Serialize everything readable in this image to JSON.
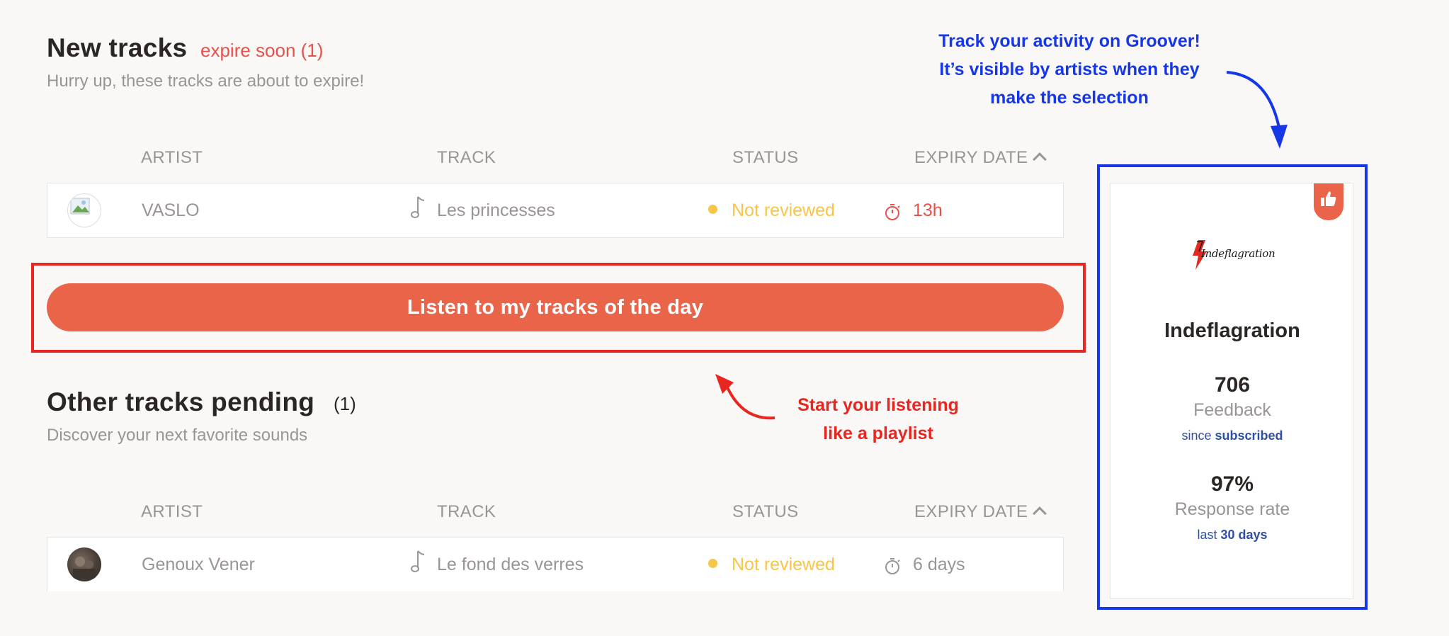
{
  "new_tracks": {
    "title": "New tracks",
    "expire_note": "expire soon (1)",
    "subtitle": "Hurry up, these tracks are about to expire!",
    "columns": [
      "ARTIST",
      "TRACK",
      "STATUS",
      "EXPIRY DATE"
    ],
    "rows": [
      {
        "artist": "VASLO",
        "track": "Les princesses",
        "status": "Not reviewed",
        "expiry": "13h"
      }
    ]
  },
  "cta": {
    "label": "Listen to my tracks of the day"
  },
  "pending": {
    "title": "Other tracks pending",
    "count": "(1)",
    "subtitle": "Discover your next favorite sounds",
    "columns": [
      "ARTIST",
      "TRACK",
      "STATUS",
      "EXPIRY DATE"
    ],
    "rows": [
      {
        "artist": "Genoux Vener",
        "track": "Le fond des verres",
        "status": "Not reviewed",
        "expiry": "6 days"
      }
    ]
  },
  "annotations": {
    "listening": [
      "Start your listening",
      "like a playlist"
    ],
    "activity": [
      "Track your activity on Groover!",
      "It’s visible by artists when they",
      "make the selection"
    ]
  },
  "profile": {
    "logo_text": "Indeflagration",
    "name": "Indeflagration",
    "feedback_value": "706",
    "feedback_label": "Feedback",
    "feedback_note_prefix": "since",
    "feedback_note_strong": "subscribed",
    "response_value": "97%",
    "response_label": "Response rate",
    "response_note_prefix": "last",
    "response_note_strong": "30 days",
    "badge_icon": "thumbs-up-icon"
  },
  "colors": {
    "accent": "#ea644a",
    "status_pending": "#f7c548",
    "expiry_urgent": "#e8504a",
    "annotation_red": "#e8261f",
    "annotation_blue": "#1637e8",
    "note_blue": "#2f4fa3"
  }
}
